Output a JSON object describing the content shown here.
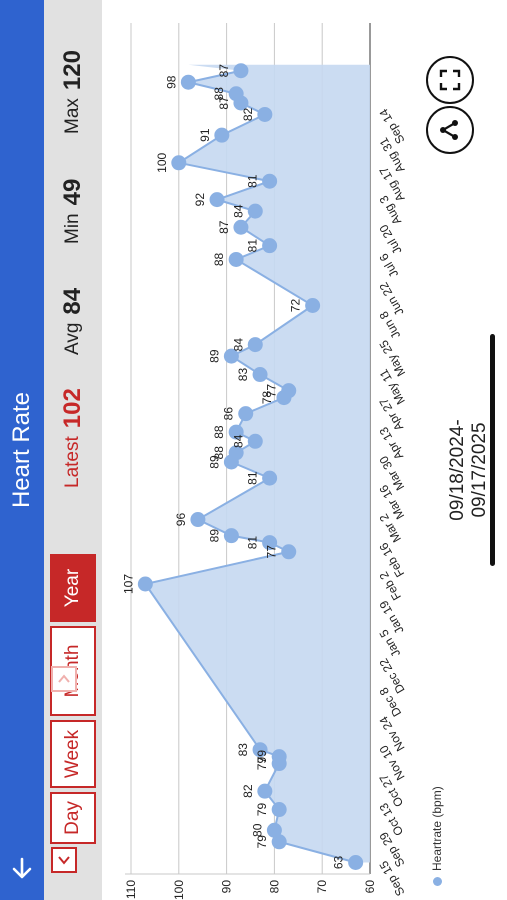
{
  "header": {
    "title": "Heart Rate"
  },
  "toolbar": {
    "segments": [
      "Day",
      "Week",
      "Month",
      "Year"
    ],
    "selected": "Year",
    "latest_label": "Latest",
    "latest_value": "102",
    "avg_label": "Avg",
    "avg_value": "84",
    "min_label": "Min",
    "min_value": "49",
    "max_label": "Max",
    "max_value": "120"
  },
  "footer": {
    "date_range": "09/18/2024-09/17/2025"
  },
  "icons": [
    "back-arrow-icon",
    "chevron-left-icon",
    "chevron-right-icon",
    "share-icon",
    "expand-icon"
  ],
  "colors": {
    "appbar": "#2f63cf",
    "accent": "#c62828",
    "series": "#8ab0e3",
    "fill": "#c5d8f1"
  },
  "chart_data": {
    "type": "area",
    "legend": "Heartrate  (bpm)",
    "legend_position": "bottom-left",
    "ylim": [
      60,
      110
    ],
    "yticks": [
      60,
      70,
      80,
      90,
      100,
      110
    ],
    "grid": true,
    "x_ticks": [
      "Sep 15",
      "Sep 29",
      "Oct 13",
      "Oct 27",
      "Nov 10",
      "Nov 24",
      "Dec 8",
      "Dec 22",
      "Jan 5",
      "Jan 19",
      "Feb 2",
      "Feb 16",
      "Mar 2",
      "Mar 16",
      "Mar 30",
      "Apr 13",
      "Apr 27",
      "May 11",
      "May 25",
      "Jun 8",
      "Jun 22",
      "Jul 6",
      "Jul 20",
      "Aug 3",
      "Aug 17",
      "Aug 31",
      "Sep 14"
    ],
    "series": [
      {
        "name": "Heartrate  (bpm)",
        "x": [
          "2024-09-18",
          "2024-09-27",
          "2024-10-02",
          "2024-10-11",
          "2024-10-19",
          "2024-10-31",
          "2024-11-03",
          "2024-11-06",
          "2025-01-17",
          "2025-01-31",
          "2025-02-04",
          "2025-02-07",
          "2025-02-14",
          "2025-03-04",
          "2025-03-11",
          "2025-03-15",
          "2025-03-20",
          "2025-03-24",
          "2025-04-01",
          "2025-04-08",
          "2025-04-11",
          "2025-04-18",
          "2025-04-26",
          "2025-05-01",
          "2025-05-18",
          "2025-06-07",
          "2025-06-13",
          "2025-06-21",
          "2025-06-28",
          "2025-07-03",
          "2025-07-11",
          "2025-07-19",
          "2025-07-31",
          "2025-08-09",
          "2025-08-14",
          "2025-08-18",
          "2025-08-23",
          "2025-08-28"
        ],
        "y": [
          63,
          79,
          80,
          79,
          82,
          79,
          79,
          83,
          107,
          77,
          81,
          89,
          96,
          81,
          89,
          88,
          84,
          88,
          86,
          78,
          77,
          83,
          89,
          84,
          72,
          88,
          81,
          87,
          84,
          92,
          81,
          100,
          91,
          82,
          87,
          88,
          98,
          87
        ]
      }
    ]
  }
}
